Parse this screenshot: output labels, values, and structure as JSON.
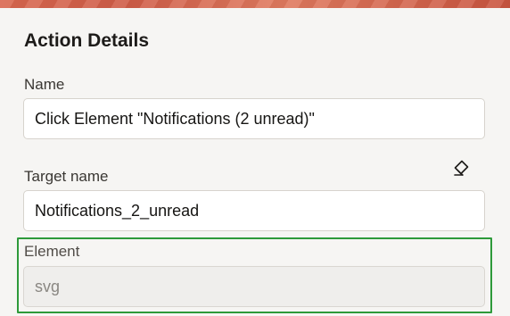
{
  "panel": {
    "title": "Action Details",
    "banner_color": "#d9674f"
  },
  "fields": {
    "name": {
      "label": "Name",
      "value": "Click Element \"Notifications (2 unread)\""
    },
    "target_name": {
      "label": "Target name",
      "value": "Notifications_2_unread",
      "clear_icon": "eraser-icon"
    },
    "element": {
      "label": "Element",
      "value": "svg",
      "disabled": true,
      "highlight_color": "#2e9a3a"
    }
  }
}
